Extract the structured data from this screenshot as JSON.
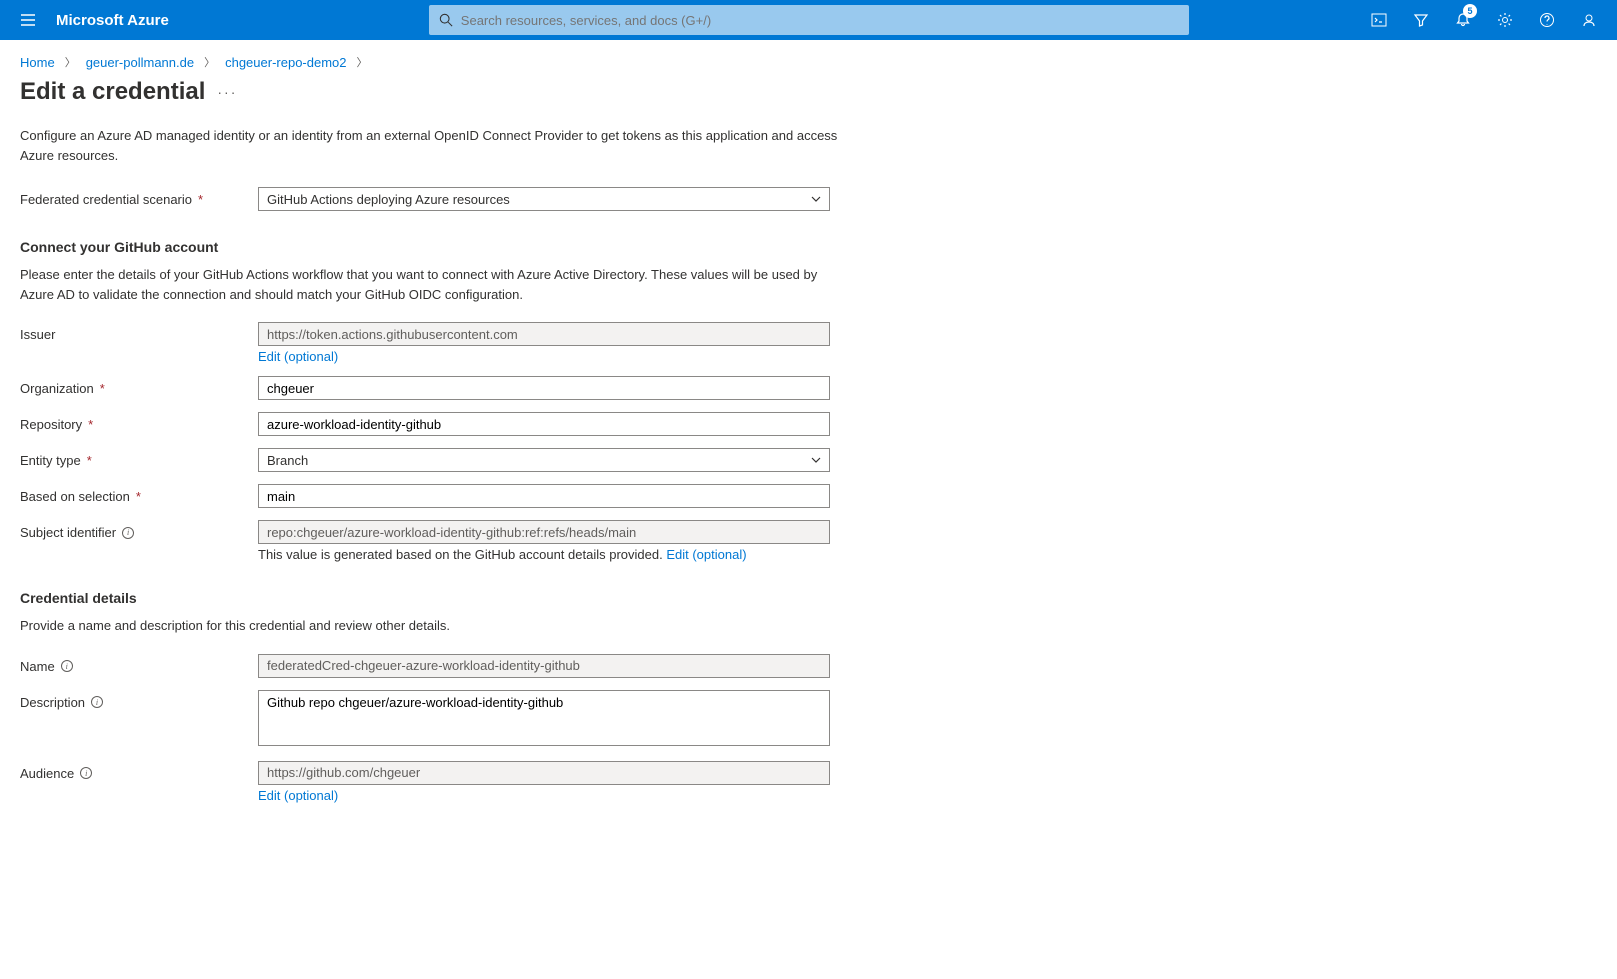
{
  "header": {
    "brand": "Microsoft Azure",
    "search_placeholder": "Search resources, services, and docs (G+/)",
    "notification_count": "5"
  },
  "breadcrumb": {
    "items": [
      "Home",
      "geuer-pollmann.de",
      "chgeuer-repo-demo2"
    ]
  },
  "page": {
    "title": "Edit a credential",
    "description": "Configure an Azure AD managed identity or an identity from an external OpenID Connect Provider to get tokens as this application and access Azure resources."
  },
  "scenario": {
    "label": "Federated credential scenario",
    "value": "GitHub Actions deploying Azure resources"
  },
  "github_section": {
    "title": "Connect your GitHub account",
    "description": "Please enter the details of your GitHub Actions workflow that you want to connect with Azure Active Directory. These values will be used by Azure AD to validate the connection and should match your GitHub OIDC configuration.",
    "issuer_label": "Issuer",
    "issuer_value": "https://token.actions.githubusercontent.com",
    "issuer_edit": "Edit (optional)",
    "organization_label": "Organization",
    "organization_value": "chgeuer",
    "repository_label": "Repository",
    "repository_value": "azure-workload-identity-github",
    "entity_type_label": "Entity type",
    "entity_type_value": "Branch",
    "based_on_label": "Based on selection",
    "based_on_value": "main",
    "subject_label": "Subject identifier",
    "subject_value": "repo:chgeuer/azure-workload-identity-github:ref:refs/heads/main",
    "subject_helper": "This value is generated based on the GitHub account details provided.",
    "subject_edit": "Edit (optional)"
  },
  "credential_section": {
    "title": "Credential details",
    "description": "Provide a name and description for this credential and review other details.",
    "name_label": "Name",
    "name_value": "federatedCred-chgeuer-azure-workload-identity-github",
    "description_label": "Description",
    "description_value": "Github repo chgeuer/azure-workload-identity-github",
    "audience_label": "Audience",
    "audience_value": "https://github.com/chgeuer",
    "audience_edit": "Edit (optional)"
  }
}
